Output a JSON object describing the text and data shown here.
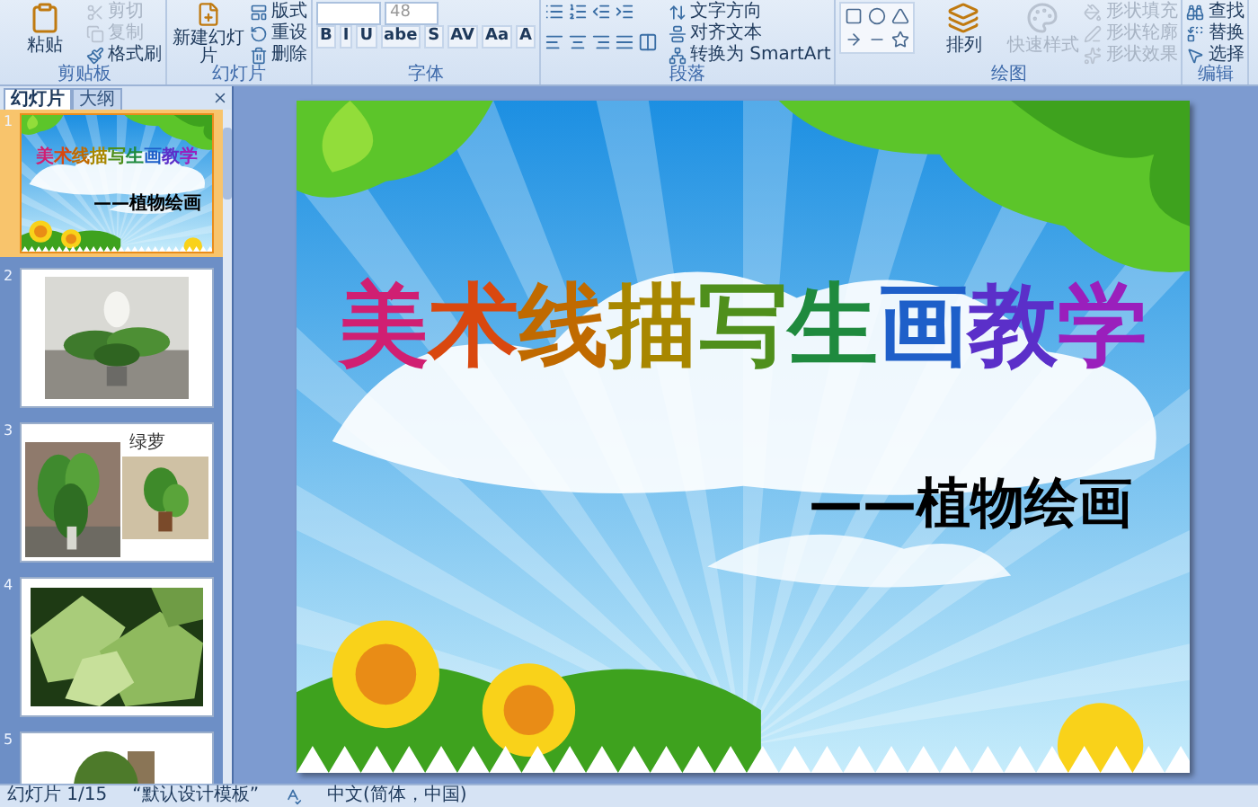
{
  "ribbon": {
    "groups": [
      {
        "kind": "plain",
        "label": "剪贴板",
        "columns": [
          [
            {
              "kind": "large",
              "label": "粘贴",
              "disabled": false
            }
          ],
          [
            {
              "kind": "small",
              "label": "剪切",
              "disabled": true
            },
            {
              "kind": "small",
              "label": "复制",
              "disabled": true
            },
            {
              "kind": "small",
              "label": "格式刷",
              "disabled": false
            }
          ]
        ]
      },
      {
        "kind": "plain",
        "label": "幻灯片",
        "columns": [
          [
            {
              "kind": "large",
              "label": "新建幻灯片",
              "disabled": false
            }
          ],
          [
            {
              "kind": "small",
              "label": "版式",
              "disabled": false
            },
            {
              "kind": "small",
              "label": "重设",
              "disabled": false
            },
            {
              "kind": "small",
              "label": "删除",
              "disabled": false
            }
          ]
        ]
      },
      {
        "kind": "plain",
        "label": "字体",
        "columns": [
          [
            {
              "kind": "row",
              "items": [
                {
                  "kind": "font-field"
                },
                {
                  "kind": "size-field",
                  "value": "48"
                }
              ]
            },
            {
              "kind": "row",
              "items": [
                {
                  "kind": "glyph",
                  "label": "B"
                },
                {
                  "kind": "glyph",
                  "label": "I"
                },
                {
                  "kind": "glyph",
                  "label": "U"
                },
                {
                  "kind": "glyph",
                  "label": "abe"
                },
                {
                  "kind": "glyph",
                  "label": "S"
                },
                {
                  "kind": "glyph",
                  "label": "AV"
                },
                {
                  "kind": "glyph",
                  "label": "Aa"
                },
                {
                  "kind": "glyph",
                  "label": "A"
                }
              ]
            }
          ]
        ]
      },
      {
        "kind": "paragraph",
        "label": "段落",
        "columns": [
          [
            {
              "kind": "small",
              "label": "文字方向",
              "disabled": false
            },
            {
              "kind": "small",
              "label": "对齐文本",
              "disabled": false
            },
            {
              "kind": "small",
              "label": "转换为 SmartArt",
              "disabled": false
            }
          ]
        ]
      },
      {
        "kind": "drawing",
        "label": "绘图",
        "columns": [
          [
            {
              "kind": "large",
              "label": "排列",
              "disabled": false
            }
          ],
          [
            {
              "kind": "large",
              "label": "快速样式",
              "disabled": true
            }
          ],
          [
            {
              "kind": "small",
              "label": "形状填充",
              "disabled": true
            },
            {
              "kind": "small",
              "label": "形状轮廓",
              "disabled": true
            },
            {
              "kind": "small",
              "label": "形状效果",
              "disabled": true
            }
          ]
        ]
      },
      {
        "kind": "plain",
        "label": "编辑",
        "columns": [
          [
            {
              "kind": "small",
              "label": "查找",
              "disabled": false
            },
            {
              "kind": "small",
              "label": "替换",
              "disabled": false
            },
            {
              "kind": "small",
              "label": "选择",
              "disabled": false
            }
          ]
        ]
      }
    ]
  },
  "slides_panel": {
    "tabs": [
      {
        "label": "幻灯片",
        "selected": true
      },
      {
        "label": "大纲",
        "selected": false
      }
    ],
    "slides": [
      {
        "number": "1",
        "kind": "title",
        "selected": true,
        "title": "美术线描写生画教学",
        "subtitle": "——植物绘画"
      },
      {
        "number": "2",
        "selected": false
      },
      {
        "number": "3",
        "kind": "photos-caption",
        "selected": false,
        "caption": "绿萝"
      },
      {
        "number": "4",
        "kind": "photo-full",
        "selected": false
      },
      {
        "number": "5",
        "kind": "photo-cut",
        "selected": false
      }
    ]
  },
  "slide": {
    "title": "美术线描写生画教学",
    "subtitle": "——植物绘画"
  },
  "status_bar": {
    "slide": "幻灯片 1/15",
    "theme": "“默认设计模板”",
    "language": "中文(简体，中国)"
  }
}
